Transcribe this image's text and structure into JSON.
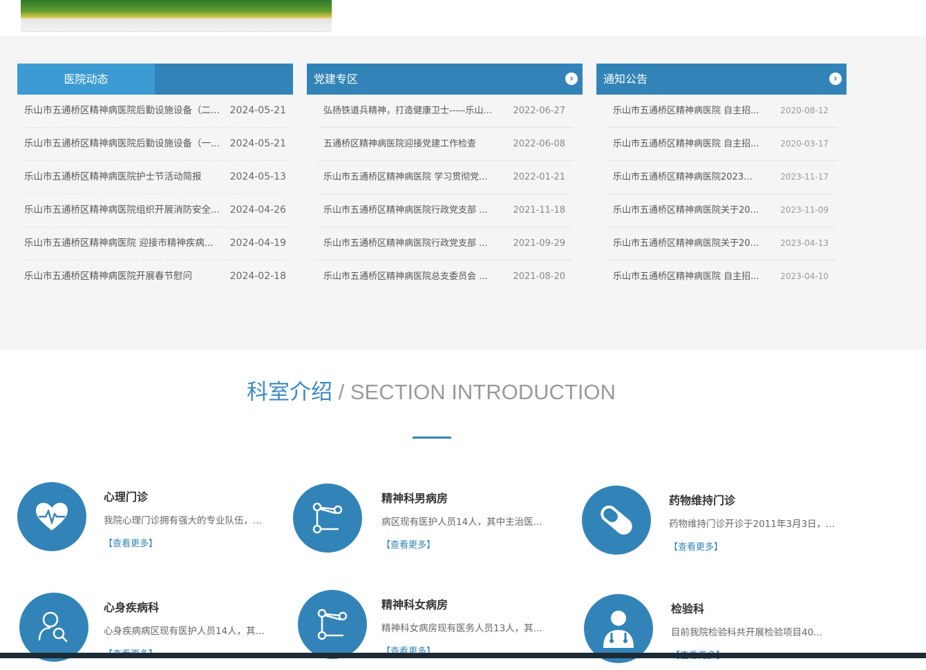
{
  "news": {
    "hospital": {
      "title": "医院动态",
      "items": [
        {
          "title": "乐山市五通桥区精神病医院后勤设施设备（二...",
          "date": "2024-05-21"
        },
        {
          "title": "乐山市五通桥区精神病医院后勤设施设备（一...",
          "date": "2024-05-21"
        },
        {
          "title": "乐山市五通桥区精神病医院护士节活动简报",
          "date": "2024-05-13"
        },
        {
          "title": "乐山市五通桥区精神病医院组织开展消防安全...",
          "date": "2024-04-26"
        },
        {
          "title": "乐山市五通桥区精神病医院  迎接市精神疾病...",
          "date": "2024-04-19"
        },
        {
          "title": "乐山市五通桥区精神病医院开展春节慰问",
          "date": "2024-02-18"
        }
      ]
    },
    "party": {
      "title": "党建专区",
      "more": "›",
      "items": [
        {
          "title": "弘扬铁道兵精神，打造健康卫士-----乐山...",
          "date": "2022-06-27"
        },
        {
          "title": "五通桥区精神病医院迎接党建工作检查",
          "date": "2022-06-08"
        },
        {
          "title": "乐山市五通桥区精神病医院 学习贯彻党...",
          "date": "2022-01-21"
        },
        {
          "title": "乐山市五通桥区精神病医院行政党支部 ...",
          "date": "2021-11-18"
        },
        {
          "title": "乐山市五通桥区精神病医院行政党支部 ...",
          "date": "2021-09-29"
        },
        {
          "title": "乐山市五通桥区精神病医院总支委员会 ...",
          "date": "2021-08-20"
        }
      ]
    },
    "notice": {
      "title": "通知公告",
      "more": "›",
      "items": [
        {
          "title": "乐山市五通桥区精神病医院 自主招...",
          "date": "2020-08-12"
        },
        {
          "title": "乐山市五通桥区精神病医院 自主招...",
          "date": "2020-03-17"
        },
        {
          "title": "乐山市五通桥区精神病医院2023年...",
          "date": "2023-11-17"
        },
        {
          "title": "乐山市五通桥区精神病医院关于20...",
          "date": "2023-11-09"
        },
        {
          "title": "乐山市五通桥区精神病医院关于20...",
          "date": "2023-04-13"
        },
        {
          "title": "乐山市五通桥区精神病医院 自主招...",
          "date": "2023-04-10"
        }
      ]
    }
  },
  "section": {
    "title_cn": "科室介绍",
    "title_en": " / SECTION INTRODUCTION"
  },
  "departments": [
    {
      "name": "心理门诊",
      "desc": "我院心理门诊拥有强大的专业队伍，...",
      "more": "【查看更多】",
      "icon": "heart-pulse-icon"
    },
    {
      "name": "精神科男病房",
      "desc": "病区现有医护人员14人，其中主治医...",
      "more": "【查看更多】",
      "icon": "network-icon"
    },
    {
      "name": "药物维持门诊",
      "desc": "药物维持门诊开诊于2011年3月3日，...",
      "more": "【查看更多】",
      "icon": "pill-icon"
    },
    {
      "name": "心身疾病科",
      "desc": "心身疾病病区现有医护人员14人，其...",
      "more": "【查看更多】",
      "icon": "person-search-icon"
    },
    {
      "name": "精神科女病房",
      "desc": "精神科女病房现有医务人员13人，其...",
      "more": "【查看更多】",
      "icon": "network-icon"
    },
    {
      "name": "检验科",
      "desc": "目前我院检验科共开展检验项目40...",
      "more": "【查看更多】",
      "icon": "doctor-icon"
    }
  ],
  "colors": {
    "accent": "#3284b8",
    "accent_light": "#3d9bd4"
  }
}
